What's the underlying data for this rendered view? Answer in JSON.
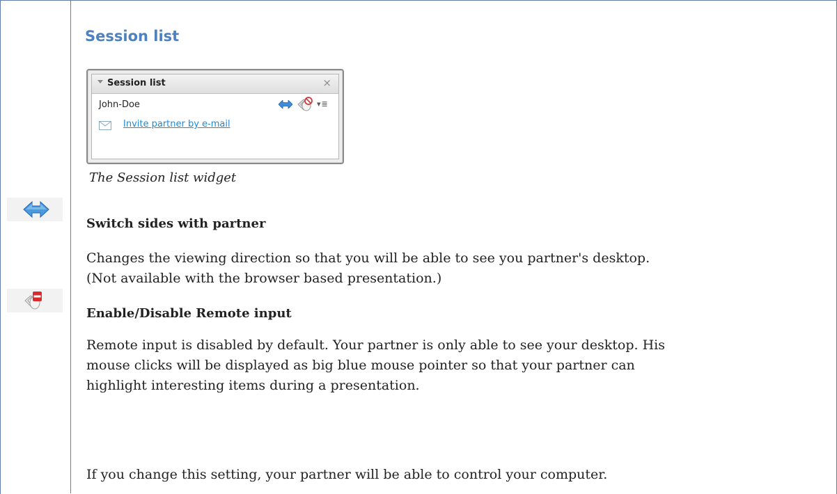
{
  "section": {
    "title": "Session list"
  },
  "widget": {
    "header_title": "Session list",
    "close_glyph": "×",
    "partner_name": "John-Doe",
    "menu_glyph": "▾≣",
    "invite_link": "Invite partner by e-mail",
    "icons": [
      "switch-sides-icon",
      "remote-input-mouse-icon",
      "options-menu-icon",
      "mail-icon"
    ]
  },
  "caption": "The Session list widget",
  "items": [
    {
      "icon": "switch-sides-icon",
      "heading": "Switch sides with partner",
      "lines": [
        "Changes the viewing direction so that you will be able to see you partner's desktop.",
        "(Not available with the browser based presentation.)"
      ]
    },
    {
      "icon": "remote-input-disabled-icon",
      "heading": "Enable/Disable Remote input",
      "lines": [
        "Remote input is disabled by default. Your partner is only able to see your desktop. His",
        "mouse clicks will be displayed as big blue mouse pointer so that your partner can",
        "highlight interesting items during a presentation."
      ],
      "extra": "If you change this setting, your partner will be able to control your computer."
    }
  ],
  "colors": {
    "title_blue": "#4f81bd",
    "link_blue": "#1d8ad8",
    "border": "#5f7fa7"
  }
}
